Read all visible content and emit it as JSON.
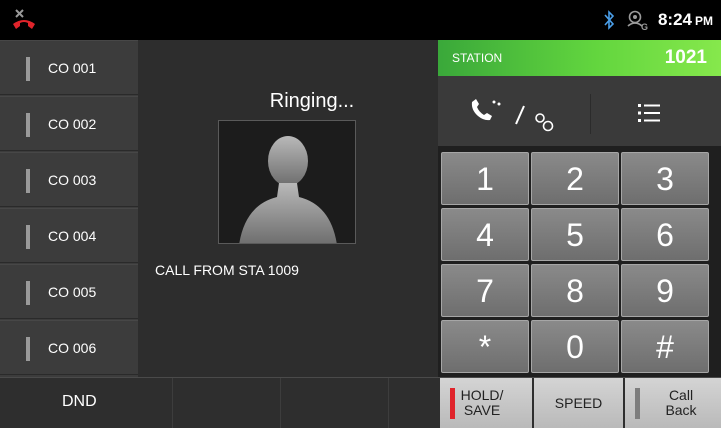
{
  "status_bar": {
    "time": "8:24",
    "time_suffix": "PM",
    "icons": [
      "missed-call-icon",
      "bluetooth-icon",
      "network-settings-icon"
    ]
  },
  "co_lines": [
    {
      "label": "CO 001"
    },
    {
      "label": "CO 002"
    },
    {
      "label": "CO 003"
    },
    {
      "label": "CO 004"
    },
    {
      "label": "CO 005"
    },
    {
      "label": "CO 006"
    }
  ],
  "call": {
    "status": "Ringing...",
    "caller": "CALL FROM STA 1009"
  },
  "station": {
    "label": "STATION",
    "number": "1021"
  },
  "keypad": {
    "keys": [
      "1",
      "2",
      "3",
      "4",
      "5",
      "6",
      "7",
      "8",
      "9",
      "*",
      "0",
      "#"
    ]
  },
  "bottom": {
    "dnd_label": "DND",
    "hold_save_line1": "HOLD/",
    "hold_save_line2": "SAVE",
    "speed_label": "SPEED",
    "call_back_line1": "Call",
    "call_back_line2": "Back"
  },
  "colors": {
    "station_green": "#62d53e",
    "hold_indicator": "#e0242b",
    "missed_call_red": "#e0242b"
  }
}
